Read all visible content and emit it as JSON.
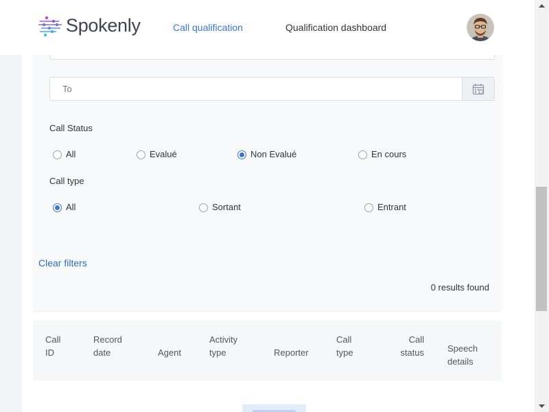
{
  "header": {
    "brand": "Spokenly",
    "nav": [
      {
        "label": "Call qualification",
        "active": true
      },
      {
        "label": "Qualification dashboard",
        "active": false
      }
    ],
    "avatar_icon": "user-avatar"
  },
  "filters": {
    "to_placeholder": "To",
    "calendar_icon": "calendar-icon",
    "call_status": {
      "label": "Call Status",
      "options": [
        "All",
        "Evalué",
        "Non Evalué",
        "En cours"
      ],
      "selected": "Non Evalué"
    },
    "call_type": {
      "label": "Call type",
      "options": [
        "All",
        "Sortant",
        "Entrant"
      ],
      "selected": "All"
    },
    "clear_label": "Clear filters",
    "results_text": "0 results found"
  },
  "table": {
    "columns": [
      [
        "Call",
        "ID"
      ],
      [
        "Record",
        "date"
      ],
      [
        "Agent"
      ],
      [
        "Activity",
        "type"
      ],
      [
        "Reporter"
      ],
      [
        "Call",
        "type"
      ],
      [
        "Call",
        "status"
      ],
      [
        "Speech",
        "details"
      ]
    ]
  },
  "colors": {
    "accent": "#3b74d1",
    "link": "#2f6dc6"
  }
}
